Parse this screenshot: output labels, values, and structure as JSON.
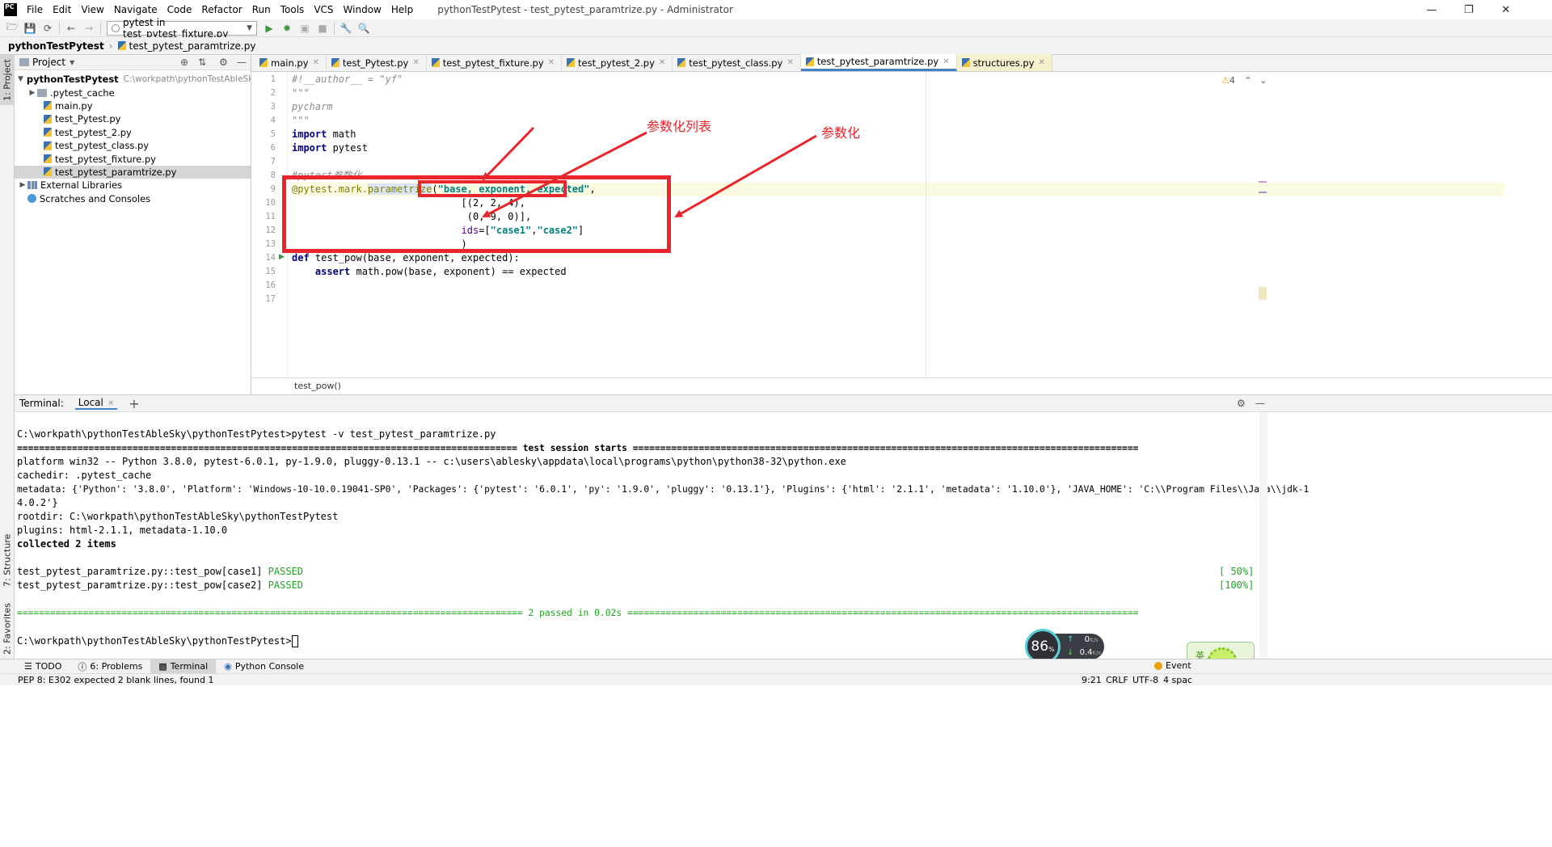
{
  "titlebar": {
    "app_icon": "PC",
    "menu": [
      "File",
      "Edit",
      "View",
      "Navigate",
      "Code",
      "Refactor",
      "Run",
      "Tools",
      "VCS",
      "Window",
      "Help"
    ],
    "title": "pythonTestPytest - test_pytest_paramtrize.py - Administrator",
    "minimize_icon": "minimize-icon",
    "maximize_icon": "restore-icon",
    "close_icon": "close-icon"
  },
  "toolbar": {
    "run_config": "pytest in test_pytest_fixture.py"
  },
  "navbar": {
    "project": "pythonTestPytest",
    "file": "test_pytest_paramtrize.py"
  },
  "left_strip": {
    "project_tab": "1: Project",
    "structure_tab": "7: Structure",
    "favorites_tab": "2: Favorites"
  },
  "project_panel": {
    "header": "Project",
    "root": "pythonTestPytest",
    "root_path": "C:\\workpath\\pythonTestAbleSky\\py",
    "items": [
      ".pytest_cache",
      "main.py",
      "test_Pytest.py",
      "test_pytest_2.py",
      "test_pytest_class.py",
      "test_pytest_fixture.py",
      "test_pytest_paramtrize.py"
    ],
    "external": "External Libraries",
    "scratches": "Scratches and Consoles"
  },
  "editor": {
    "tabs": [
      "main.py",
      "test_Pytest.py",
      "test_pytest_fixture.py",
      "test_pytest_2.py",
      "test_pytest_class.py",
      "test_pytest_paramtrize.py",
      "structures.py"
    ],
    "warning_count": "4",
    "line_numbers": [
      "1",
      "2",
      "3",
      "4",
      "5",
      "6",
      "7",
      "8",
      "9",
      "10",
      "11",
      "12",
      "13",
      "14",
      "15",
      "16",
      "17"
    ],
    "lines": {
      "l1": "#!__author__ = \"yf\"",
      "l2": "\"\"\"",
      "l3": "pycharm",
      "l4": "\"\"\"",
      "l5a": "import",
      "l5b": " math",
      "l6a": "import",
      "l6b": " pytest",
      "l8": "#pytest参数化",
      "l9a": "@pytest.mark.",
      "l9b": "parametrize",
      "l9c": "(",
      "l9d": "\"base, exponent, expected\"",
      "l9e": ",",
      "l10": "                             [(2, 2, 4),",
      "l11": "                              (0, 9, 0)],",
      "l12a": "                             ",
      "l12b": "ids",
      "l12c": "=[",
      "l12d": "\"case1\"",
      "l12e": ",",
      "l12f": "\"case2\"",
      "l12g": "]",
      "l13": "                             )",
      "l14a": "def",
      "l14b": " test_pow(base, exponent, expected):",
      "l15a": "    assert",
      "l15b": " math.pow(base, exponent) == expected"
    },
    "breadcrumb": "test_pow()"
  },
  "annotations": {
    "list_label": "参数化列表",
    "param_label": "参数化"
  },
  "terminal": {
    "label": "Terminal:",
    "tab": "Local",
    "lines": [
      "C:\\workpath\\pythonTestAbleSky\\pythonTestPytest>pytest -v test_pytest_paramtrize.py",
      "=========================================================================================== test session starts ============================================================================================",
      "platform win32 -- Python 3.8.0, pytest-6.0.1, py-1.9.0, pluggy-0.13.1 -- c:\\users\\ablesky\\appdata\\local\\programs\\python\\python38-32\\python.exe",
      "cachedir: .pytest_cache",
      "metadata: {'Python': '3.8.0', 'Platform': 'Windows-10-10.0.19041-SP0', 'Packages': {'pytest': '6.0.1', 'py': '1.9.0', 'pluggy': '0.13.1'}, 'Plugins': {'html': '2.1.1', 'metadata': '1.10.0'}, 'JAVA_HOME': 'C:\\\\Program Files\\\\Java\\\\jdk-1",
      "4.0.2'}",
      "rootdir: C:\\workpath\\pythonTestAbleSky\\pythonTestPytest",
      "plugins: html-2.1.1, metadata-1.10.0",
      "collected 2 items"
    ],
    "result1_name": "test_pytest_paramtrize.py::test_pow[case1] ",
    "result1_status": "PASSED",
    "result1_pct": "[ 50%]",
    "result2_name": "test_pytest_paramtrize.py::test_pow[case2] ",
    "result2_status": "PASSED",
    "result2_pct": "[100%]",
    "summary": "============================================================================================ 2 passed in 0.02s =============================================================================================",
    "prompt": "C:\\workpath\\pythonTestAbleSky\\pythonTestPytest>"
  },
  "bottom_tabs": [
    "TODO",
    "6: Problems",
    "Terminal",
    "Python Console"
  ],
  "event_log": "Event",
  "status": {
    "message": "PEP 8: E302 expected 2 blank lines, found 1",
    "position": "9:21",
    "line_sep": "CRLF",
    "encoding": "UTF-8",
    "indent": "4 spac"
  },
  "net_widget": {
    "cpu": "86",
    "cpu_unit": "%",
    "up": "0",
    "up_unit": "K/s",
    "down": "0.4",
    "down_unit": "K/s"
  },
  "ime": "英"
}
